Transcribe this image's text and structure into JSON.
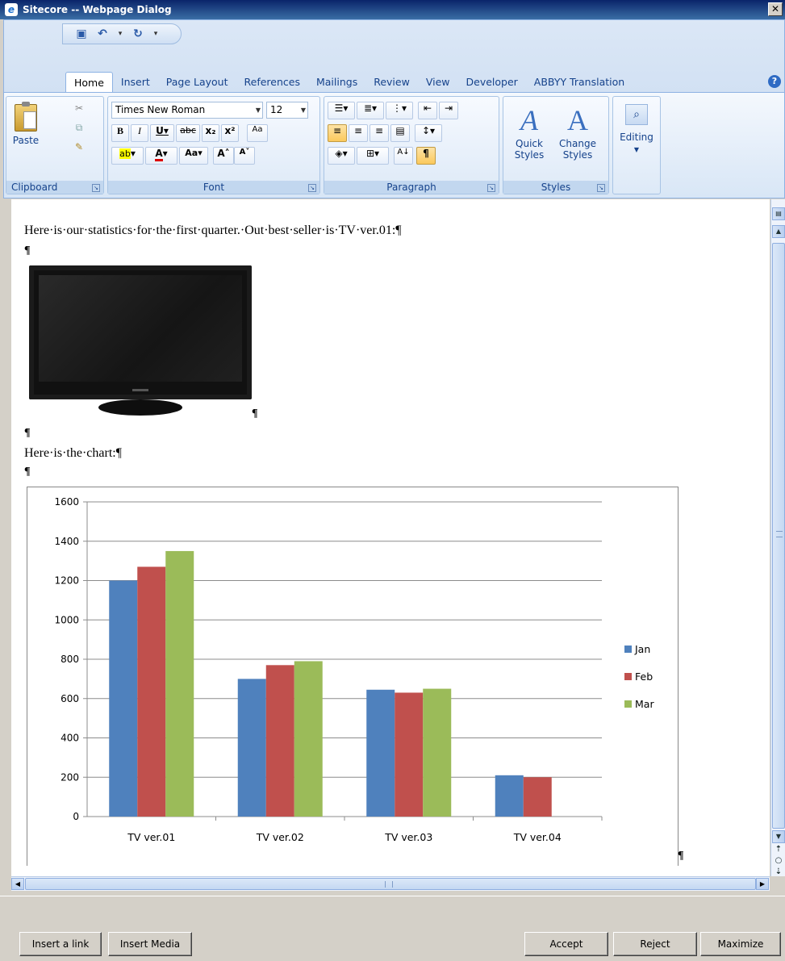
{
  "window": {
    "title": "Sitecore -- Webpage Dialog",
    "close_label": "✕"
  },
  "ribbon": {
    "tabs": [
      "Home",
      "Insert",
      "Page Layout",
      "References",
      "Mailings",
      "Review",
      "View",
      "Developer",
      "ABBYY Translation"
    ],
    "clipboard": {
      "paste_label": "Paste",
      "group_label": "Clipboard"
    },
    "font": {
      "family": "Times New Roman",
      "size": "12",
      "group_label": "Font"
    },
    "paragraph": {
      "group_label": "Paragraph"
    },
    "styles": {
      "quick_styles_label": "Quick Styles",
      "change_styles_label": "Change Styles",
      "group_label": "Styles"
    },
    "editing": {
      "label": "Editing"
    }
  },
  "document": {
    "intro_text": "Here·is·our·statistics·for·the·first·quarter.·Out·best·seller·is·TV·ver.01:¶",
    "chart_intro_text": "Here·is·the·chart:¶",
    "pilcrow": "¶"
  },
  "chart_data": {
    "type": "bar",
    "categories": [
      "TV ver.01",
      "TV ver.02",
      "TV ver.03",
      "TV ver.04"
    ],
    "series": [
      {
        "name": "Jan",
        "values": [
          1200,
          700,
          645,
          210
        ],
        "color": "#4f81bd"
      },
      {
        "name": "Feb",
        "values": [
          1270,
          770,
          630,
          200
        ],
        "color": "#c0504d"
      },
      {
        "name": "Mar",
        "values": [
          1350,
          790,
          650,
          0
        ],
        "color": "#9bbb59"
      }
    ],
    "ylim": [
      0,
      1600
    ],
    "yticks": [
      0,
      200,
      400,
      600,
      800,
      1000,
      1200,
      1400,
      1600
    ],
    "grid": true,
    "legend": "right"
  },
  "footer": {
    "insert_link": "Insert a link",
    "insert_media": "Insert Media",
    "accept": "Accept",
    "reject": "Reject",
    "maximize": "Maximize"
  }
}
